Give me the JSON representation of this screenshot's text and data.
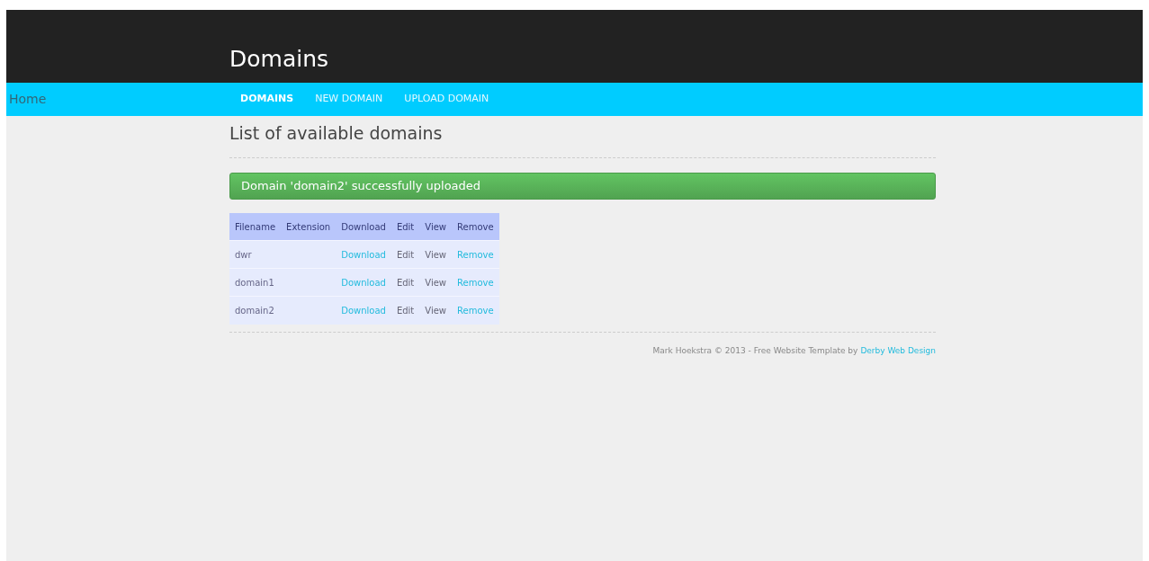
{
  "header": {
    "title": "Domains"
  },
  "nav": {
    "home": "Home",
    "tabs": [
      {
        "label": "DOMAINS",
        "selected": true
      },
      {
        "label": "NEW DOMAIN",
        "selected": false
      },
      {
        "label": "UPLOAD DOMAIN",
        "selected": false
      }
    ]
  },
  "heading": "List of available domains",
  "alert": "Domain 'domain2' successfully uploaded",
  "table": {
    "columns": [
      "Filename",
      "Extension",
      "Download",
      "Edit",
      "View",
      "Remove"
    ],
    "rows": [
      {
        "filename": "dwr",
        "download": "Download",
        "edit": "Edit",
        "view": "View",
        "remove": "Remove"
      },
      {
        "filename": "domain1",
        "download": "Download",
        "edit": "Edit",
        "view": "View",
        "remove": "Remove"
      },
      {
        "filename": "domain2",
        "download": "Download",
        "edit": "Edit",
        "view": "View",
        "remove": "Remove"
      }
    ]
  },
  "footer": {
    "text": "Mark Hoekstra © 2013 - Free Website Template by",
    "link": "Derby Web Design"
  }
}
